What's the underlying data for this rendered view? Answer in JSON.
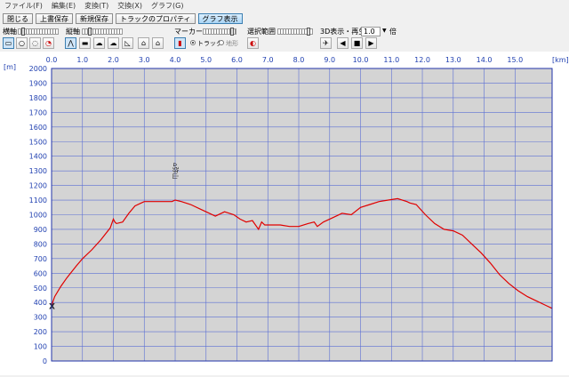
{
  "menu": [
    "ファイル(F)",
    "編集(E)",
    "変換(T)",
    "交換(X)",
    "グラフ(G)"
  ],
  "toolbar": {
    "close": "閉じる",
    "overwrite_save": "上書保存",
    "new_save": "新規保存",
    "track_properties": "トラックのプロパティ",
    "graph_display": "グラフ表示"
  },
  "controls": {
    "horizontal_axis": "横軸",
    "vertical_axis": "縦軸",
    "marker": "マーカー",
    "selection_range": "選択範囲",
    "display_3d": "3D表示・再生",
    "speed_value": "1.0",
    "speed_unit": "倍",
    "radio_track": "トラック",
    "radio_terrain": "地形"
  },
  "colors": {
    "line": "#e00000",
    "plot_bg": "#d4d4d4",
    "grid": "#5b6fd4",
    "axis_text": "#1f3fb0",
    "frame": "#2233aa"
  },
  "chart_data": {
    "type": "line",
    "xunit": "[km]",
    "yunit": "[m]",
    "xlim": [
      0,
      16.2
    ],
    "ylim": [
      0,
      2000
    ],
    "xticks": [
      0,
      1,
      2,
      3,
      4,
      5,
      6,
      7,
      8,
      9,
      10,
      11,
      12,
      13,
      14,
      15
    ],
    "xtick_labels": [
      "0.0",
      "1.0",
      "2.0",
      "3.0",
      "4.0",
      "5.0",
      "6.0",
      "7.0",
      "8.0",
      "9.0",
      "10.0",
      "11.0",
      "12.0",
      "13.0",
      "14.0",
      "15.0"
    ],
    "yticks": [
      0,
      100,
      200,
      300,
      400,
      500,
      600,
      700,
      800,
      900,
      1000,
      1100,
      1200,
      1300,
      1400,
      1500,
      1600,
      1700,
      1800,
      1900,
      2000
    ],
    "grid": true,
    "marker_label": "⌂弥山",
    "marker_x": 4.0,
    "start_marker": "X",
    "x": [
      0,
      0.1,
      0.3,
      0.5,
      0.8,
      1.0,
      1.3,
      1.6,
      1.9,
      2.0,
      2.05,
      2.1,
      2.3,
      2.5,
      2.7,
      2.9,
      3.0,
      3.3,
      3.6,
      3.9,
      4.0,
      4.2,
      4.5,
      4.8,
      5.0,
      5.3,
      5.6,
      5.9,
      6.1,
      6.3,
      6.5,
      6.7,
      6.8,
      6.9,
      7.1,
      7.4,
      7.7,
      8.0,
      8.3,
      8.5,
      8.6,
      8.8,
      9.1,
      9.4,
      9.7,
      10.0,
      10.3,
      10.6,
      10.9,
      11.2,
      11.5,
      11.6,
      11.8,
      12.1,
      12.4,
      12.7,
      13.0,
      13.3,
      13.6,
      13.9,
      14.2,
      14.5,
      14.8,
      15.1,
      15.4,
      15.7,
      16.0,
      16.2
    ],
    "y": [
      380,
      440,
      510,
      570,
      650,
      700,
      760,
      830,
      910,
      970,
      950,
      940,
      950,
      1010,
      1060,
      1080,
      1090,
      1090,
      1090,
      1090,
      1100,
      1090,
      1070,
      1040,
      1020,
      990,
      1020,
      1000,
      970,
      950,
      960,
      900,
      950,
      930,
      930,
      930,
      920,
      920,
      940,
      950,
      920,
      950,
      980,
      1010,
      1000,
      1050,
      1070,
      1090,
      1100,
      1110,
      1090,
      1080,
      1070,
      1000,
      940,
      900,
      890,
      860,
      800,
      740,
      670,
      590,
      530,
      480,
      440,
      410,
      380,
      360
    ]
  }
}
